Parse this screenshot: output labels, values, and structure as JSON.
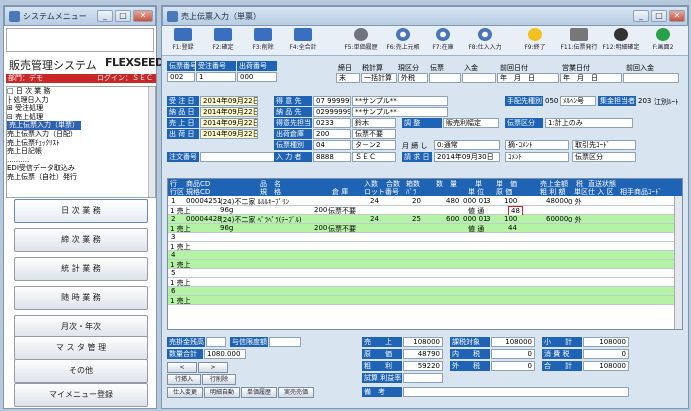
{
  "menu_window": {
    "title": "システムメニュー",
    "app_name": "販売管理システム",
    "brand": "FLEXSEED",
    "dept": "部門：デモ",
    "login": "ログイン：ＳＥＣ",
    "tree": [
      "□ 日 次 業 務",
      "  ├ 処理日入力",
      "  ⊞ 受注処理",
      "  ⊟ 売上処理",
      "     売上伝票入力（単票）",
      "     売上伝票入力（日配）",
      "     売上伝票ﾁｪｯｸﾘｽﾄ",
      "     売上日記帳",
      "     ..........",
      "     EDI受信データ取込み",
      "     売上伝票（自社）発行"
    ],
    "buttons": [
      "日 次 業 務",
      "締 次 業 務",
      "統 計 業 務",
      "随 時 業 務",
      "月次・年次",
      "マ ス タ 管 理",
      "その他",
      "マイメニュー登録"
    ]
  },
  "main_window": {
    "title": "売上伝票入力（単票）",
    "toolbar": [
      "F1:登録",
      "F2:確定",
      "F3:削除",
      "F4:全合計",
      "F5:単価履歴",
      "F6:売上元帳",
      "F7:在庫",
      "F8:仕入入力",
      "F9:終了",
      "F11:伝票発行",
      "F12:明細確定",
      "F:画面2"
    ],
    "header_labels": [
      "伝票番号",
      "受注番号",
      "出荷番号"
    ],
    "header_values": [
      "002",
      "1",
      "000"
    ],
    "top_right_labels": [
      "締日",
      "税計算",
      "現区分",
      "伝票",
      "入金",
      "前回日付",
      "営業日付",
      "前回入金"
    ],
    "top_right_values": [
      "末",
      "一括計算",
      "外税",
      "",
      "",
      "年　月　日",
      "年　月　日",
      ""
    ],
    "row_labels": [
      "受 注 日",
      "納 品 日",
      "売 上 日",
      "出 荷 日",
      "注文番号"
    ],
    "row_dates": [
      "2014年09月22日",
      "2014年09月22日",
      "2014年09月22日",
      "2014年09月22日",
      ""
    ],
    "customer": {
      "l1": "得 意 先",
      "v1": "07 999999",
      "n1": "**サンプル**",
      "l2": "納 品 先",
      "v2": "02999999",
      "n2": "**サンプル**",
      "l3": "得意先担当",
      "v3": "0233",
      "n3": "鈴木",
      "l4": "出荷倉庫",
      "v4": "200",
      "n4": "伝票不要",
      "l5": "伝票種別",
      "v5": "04",
      "n5": "タ－ン2",
      "l6": "入 力 者",
      "v6": "8888",
      "n6": "ＳＥＣ"
    },
    "misc": {
      "flag": "調 整",
      "flag_val": "販売利幅定",
      "month_label": "月 締 し",
      "month_val": "0:通常",
      "issue_label": "請 求 日",
      "issue_val": "2014年09月30日",
      "kind_label": "伝票区分",
      "kind_val": "1:計上のみ",
      "cust_label": "手配先種別",
      "cust_val": "050",
      "cust_name": "ﾒﾙﾍﾝ号",
      "route_label": "集金担当者",
      "route_val": "203",
      "route_name": "江別ﾙｰﾄ",
      "d1": "摘･ｺﾒﾝﾄ",
      "d2": "取引先ｺｰﾄﾞ",
      "d3": "ｺﾒﾝﾄ ",
      "d4": "伝票区分"
    },
    "grid_head": [
      "行",
      "商品CD",
      "品　名",
      "入数",
      "合数",
      "箱数",
      "数　量",
      "単",
      "単　価",
      "売上金額",
      "税",
      "直送状態",
      "行区",
      "規格CD",
      "規　格",
      "倉 庫",
      "ロット番号",
      "ﾊﾞﾗ",
      "単 位",
      "原 価",
      "粗 利 額",
      "単区",
      "仕 入 区",
      "相手商品ｺｰﾄﾞ"
    ],
    "rows": [
      {
        "no": "1",
        "cd": "00004251",
        "name": "(24)不二家 ﾙﾙﾙｷｰﾌﾟﾘﾝ",
        "qty_in": "24",
        "box": "20",
        "qty": "480",
        "unit": "000 01",
        "tax": "3",
        "price": "100",
        "amount": "48000",
        "rate": "0 外",
        "kbn": "1 売上",
        "spec": "96g",
        "wh": "200",
        "whn": "伝票不要",
        "t": "値 通",
        "cost": "48",
        "margin": ""
      },
      {
        "no": "2",
        "cd": "00004428",
        "name": "(24)不二家 ﾍﾟﾗﾍﾟﾗ(ﾃｰﾌﾞﾙ)",
        "qty_in": "24",
        "box": "25",
        "qty": "600",
        "unit": "000 01",
        "tax": "3",
        "price": "100",
        "amount": "60000",
        "rate": "0 外",
        "kbn": "1 売上",
        "spec": "96g",
        "wh": "200",
        "whn": "伝票不要",
        "t": "値 通",
        "cost": "44",
        "margin": "500"
      },
      {
        "no": "3",
        "kbn": "1 売上"
      },
      {
        "no": "4",
        "kbn": "1 売上"
      },
      {
        "no": "5",
        "kbn": "1 売上"
      },
      {
        "no": "6",
        "kbn": "1 売上"
      }
    ],
    "bottom": {
      "stock_label": "売掛金残高",
      "credit_label": "与信限度額",
      "count_label": "数量合計",
      "count_val": "1080.000",
      "row_ins": "行挿入",
      "row_del": "行削除",
      "b1": "仕入変更",
      "b2": "明細自動",
      "b3": "単価履歴",
      "b4": "実売売価",
      "sum_labels": [
        "売　　上",
        "原　　価",
        "粗　　利",
        "試算 利益率"
      ],
      "sum_vals": [
        "108000",
        "48790",
        "59220",
        ""
      ],
      "tax_labels": [
        "課税対象",
        "内　　税",
        "外　　税"
      ],
      "tax_vals": [
        "108000",
        "0",
        "0"
      ],
      "tot_labels": [
        "小　　計",
        "消 費 税",
        "合　　計"
      ],
      "tot_vals": [
        "108000",
        "0",
        "108000"
      ],
      "note_label": "備　考"
    }
  }
}
